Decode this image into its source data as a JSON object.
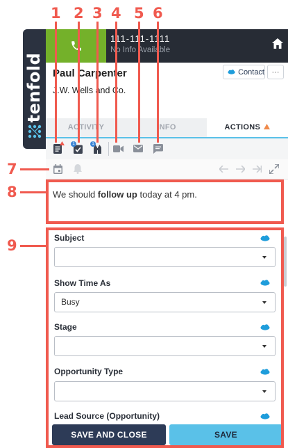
{
  "brand": {
    "name": "tenfold"
  },
  "header": {
    "phone_number": "111-111-1111",
    "phone_info": "No Info Available",
    "contact_name": "Paul Carpenter",
    "company": "J.W. Wells and Co.",
    "contact_button": "Contact",
    "more_button": "···"
  },
  "tabs": [
    {
      "label": "ACTIVITY"
    },
    {
      "label": "INFO"
    },
    {
      "label": "ACTIONS",
      "active": true
    }
  ],
  "action_icons": [
    "note-icon",
    "task-icon",
    "opportunity-icon",
    "video-icon",
    "email-icon",
    "sms-icon"
  ],
  "badges": {
    "task": "1",
    "opportunity": "1"
  },
  "note": {
    "before": "We should ",
    "bold": "follow up",
    "after": " today at 4 pm."
  },
  "form": {
    "fields": [
      {
        "label": "Subject",
        "value": ""
      },
      {
        "label": "Show Time As",
        "value": "Busy"
      },
      {
        "label": "Stage",
        "value": ""
      },
      {
        "label": "Opportunity Type",
        "value": ""
      },
      {
        "label": "Lead Source (Opportunity)",
        "value": ""
      }
    ]
  },
  "buttons": {
    "save_and_close": "SAVE AND CLOSE",
    "save": "SAVE"
  },
  "callouts": [
    "1",
    "2",
    "3",
    "4",
    "5",
    "6",
    "7",
    "8",
    "9"
  ],
  "colors": {
    "accent": "#5ac1e8",
    "callout": "#f05a4f",
    "call_green": "#74b12a",
    "dark": "#272c35",
    "navy_button": "#2d3b57"
  }
}
